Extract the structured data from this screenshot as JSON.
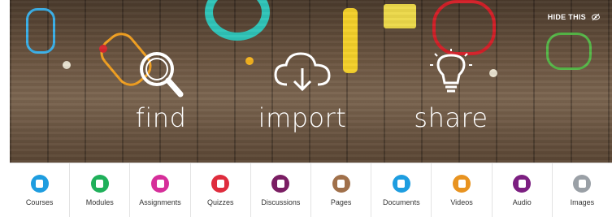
{
  "hero": {
    "hide_label": "HIDE THIS",
    "actions": [
      {
        "label": "find",
        "icon": "magnifier-icon"
      },
      {
        "label": "import",
        "icon": "cloud-download-icon"
      },
      {
        "label": "share",
        "icon": "lightbulb-icon"
      }
    ]
  },
  "content_types": [
    {
      "label": "Courses",
      "color": "#1e9de0",
      "icon": "course-icon"
    },
    {
      "label": "Modules",
      "color": "#1fb05a",
      "icon": "modules-icon"
    },
    {
      "label": "Assignments",
      "color": "#d62e9a",
      "icon": "assignment-icon"
    },
    {
      "label": "Quizzes",
      "color": "#df2c3d",
      "icon": "quiz-icon"
    },
    {
      "label": "Discussions",
      "color": "#7a1e63",
      "icon": "discussion-icon"
    },
    {
      "label": "Pages",
      "color": "#a0704a",
      "icon": "page-icon"
    },
    {
      "label": "Documents",
      "color": "#1e9de0",
      "icon": "document-icon"
    },
    {
      "label": "Videos",
      "color": "#e89320",
      "icon": "video-icon"
    },
    {
      "label": "Audio",
      "color": "#7c1f81",
      "icon": "audio-icon"
    },
    {
      "label": "Images",
      "color": "#9aa0a6",
      "icon": "image-icon"
    }
  ]
}
